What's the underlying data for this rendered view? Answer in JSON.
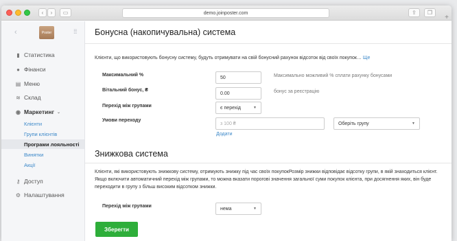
{
  "browser": {
    "url": "demo.joinposter.com"
  },
  "sidebar": {
    "logo_text": "Poster",
    "items": [
      {
        "label": "Статистика",
        "icon": "bar-chart-icon"
      },
      {
        "label": "Фінанси",
        "icon": "money-icon"
      },
      {
        "label": "Меню",
        "icon": "document-icon"
      },
      {
        "label": "Склад",
        "icon": "stack-icon"
      },
      {
        "label": "Маркетинг",
        "icon": "target-icon",
        "expanded": true
      },
      {
        "label": "Доступ",
        "icon": "key-icon"
      },
      {
        "label": "Налаштування",
        "icon": "gear-icon"
      }
    ],
    "marketing_sub": [
      {
        "label": "Клієнти"
      },
      {
        "label": "Групи клієнтів"
      },
      {
        "label": "Програми лояльності",
        "active": true
      },
      {
        "label": "Винятки"
      },
      {
        "label": "Акції"
      }
    ]
  },
  "bonus": {
    "title": "Бонусна (накопичувальна) система",
    "description": "Клієнти, що використовують бонусну систему, будуть отримувати на свій бонусний рахунок відсоток від своїх покупок…",
    "more_link": "Ще",
    "max_label": "Максимальний %",
    "max_value": "50",
    "max_hint": "Максимально можливий % сплати рахунку бонусами",
    "welcome_label": "Вітальний бонус, ₴",
    "welcome_value": "0.00",
    "welcome_hint": "бонус за реєстрацію",
    "transition_label": "Перехід між групами",
    "transition_value": "є перехід",
    "conditions_label": "Умови переходу",
    "conditions_placeholder": "з 100 ₴",
    "group_select": "Оберіть групу",
    "add_link": "Додати"
  },
  "discount": {
    "title": "Знижкова система",
    "description": "Клієнти, які використовують знижкову систему, отримують знижку під час своїх покупокРозмір знижки відповідає відсотку групи, в якій знаходиться клієнт. Якщо включити автоматичний перехід між групами, то можна вказати порогові значення загальної суми покупок клієнта, при досягнення яких, він буде переходити в групу з більш високим відсотком знижки.",
    "transition_label": "Перехід між групами",
    "transition_value": "нема"
  },
  "save_label": "Зберегти",
  "colors": {
    "accent": "#2eae3a",
    "link": "#3a87c8"
  }
}
